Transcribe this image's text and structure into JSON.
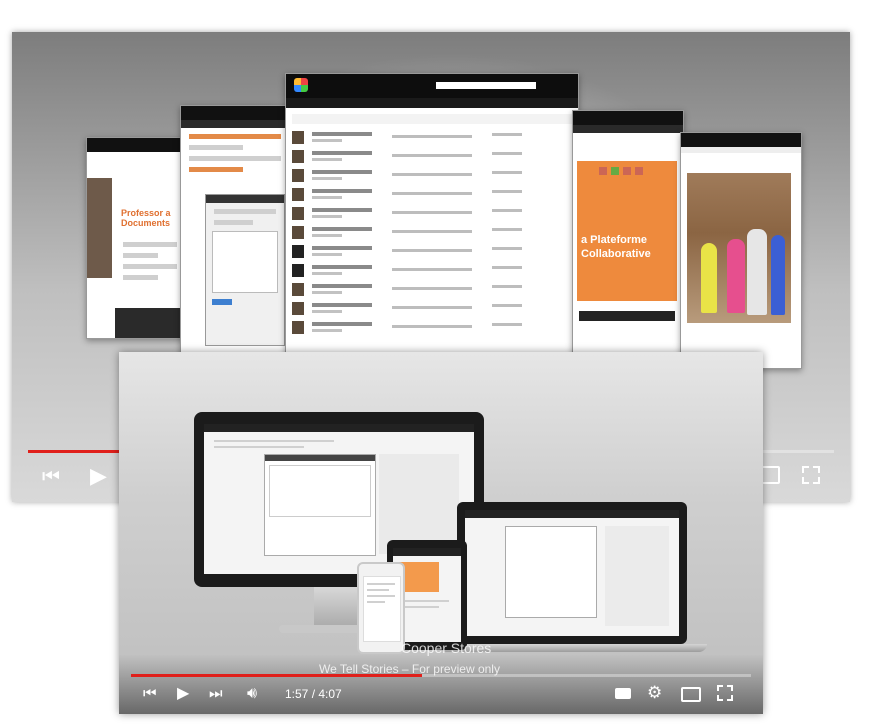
{
  "back_player": {
    "slide_title": "Professor a Documents",
    "orange_headline": "a Plateforme Collaborative",
    "progress_fraction": 0.12
  },
  "front_player": {
    "watermark": "Cooper Stores",
    "subtitle": "We Tell Stories – For preview only",
    "current_time": "1:57",
    "separator": " / ",
    "duration": "4:07",
    "progress_fraction": 0.47,
    "accent_color": "#e0201b"
  },
  "icons": {
    "prev": "skip-previous-icon",
    "play": "play-icon",
    "next": "skip-next-icon",
    "volume": "volume-icon",
    "captions": "captions-icon",
    "settings": "gear-icon",
    "theater": "theater-mode-icon",
    "fullscreen": "fullscreen-icon"
  }
}
